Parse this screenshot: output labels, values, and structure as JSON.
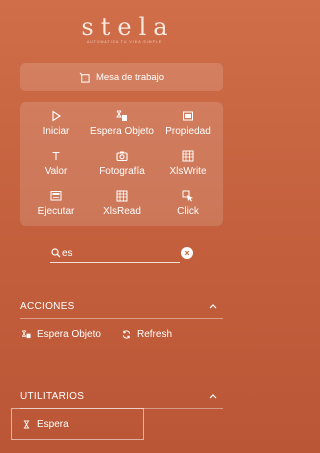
{
  "brand": {
    "logo_text": "stela",
    "tagline": "AUTOMATIZA TU VIDA SIMPLE"
  },
  "workspace_button": {
    "label": "Mesa de trabajo",
    "icon": "workspace-icon"
  },
  "tools": [
    {
      "label": "Iniciar",
      "icon": "play-icon"
    },
    {
      "label": "Espera Objeto",
      "icon": "wait-object-icon"
    },
    {
      "label": "Propiedad",
      "icon": "property-icon"
    },
    {
      "label": "Valor",
      "icon": "text-value-icon"
    },
    {
      "label": "Fotografía",
      "icon": "camera-icon"
    },
    {
      "label": "XlsWrite",
      "icon": "spreadsheet-write-icon"
    },
    {
      "label": "Ejecutar",
      "icon": "execute-icon"
    },
    {
      "label": "XlsRead",
      "icon": "spreadsheet-read-icon"
    },
    {
      "label": "Click",
      "icon": "click-icon"
    }
  ],
  "search": {
    "value": "es",
    "placeholder": ""
  },
  "sections": {
    "acciones": {
      "title": "ACCIONES",
      "items": [
        {
          "label": "Espera Objeto",
          "icon": "wait-object-icon"
        },
        {
          "label": "Refresh",
          "icon": "refresh-icon"
        }
      ]
    },
    "utilitarios": {
      "title": "UTILITARIOS",
      "items": [
        {
          "label": "Espera",
          "icon": "hourglass-icon"
        }
      ]
    }
  },
  "colors": {
    "background_top": "#cf6e49",
    "background_bottom": "#ba5636",
    "text": "#ffffff"
  }
}
